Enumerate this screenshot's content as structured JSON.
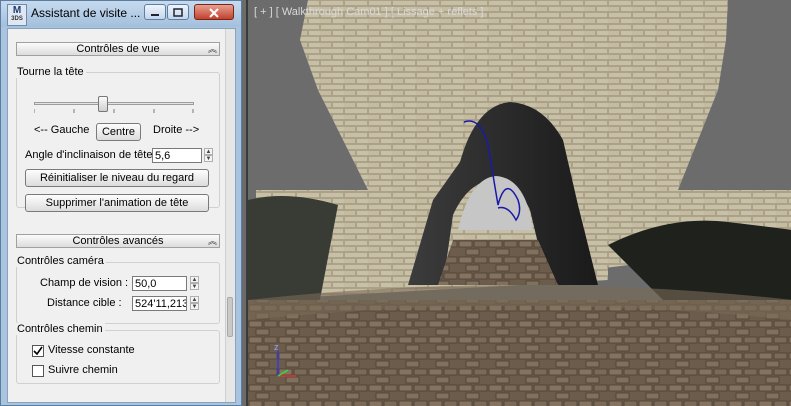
{
  "window": {
    "title": "Assistant de visite ...",
    "icon_text": "M",
    "icon_sub": "3DS",
    "minimize_icon": "minimize-icon",
    "maximize_icon": "maximize-icon",
    "close_icon": "close-icon"
  },
  "view_controls": {
    "header": "Contrôles de vue",
    "collapse_glyph": "«",
    "turn_head": {
      "label": "Tourne la tête",
      "slider_value": 0.5,
      "left_label": "<-- Gauche",
      "center_button": "Centre",
      "right_label": "Droite -->"
    },
    "tilt_label": "Angle d'inclinaison de tête",
    "tilt_value": "5,6",
    "reset_button": "Réinitialiser le niveau du regard",
    "remove_anim_button": "Supprimer l'animation de tête"
  },
  "advanced_controls": {
    "header": "Contrôles avancés",
    "collapse_glyph": "«",
    "camera": {
      "label": "Contrôles caméra",
      "fov_label": "Champ de vision :",
      "fov_value": "50,0",
      "target_label": "Distance cible :",
      "target_value": "524'11,213"
    },
    "path": {
      "label": "Contrôles chemin",
      "constant_speed_label": "Vitesse constante",
      "constant_speed_checked": true,
      "follow_path_label": "Suivre chemin",
      "follow_path_checked": false
    }
  },
  "viewport": {
    "label": "[ + ] [ Walkthrough Cam01 ] [ Lissage + reflets ]",
    "axis_z": "z"
  },
  "colors": {
    "title_bar": "#a9c4de",
    "panel": "#f0f0f0",
    "close_button": "#c2412c",
    "path_curve": "#1a1aa8"
  }
}
